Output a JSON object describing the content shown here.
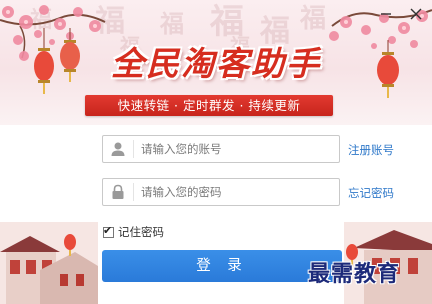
{
  "banner": {
    "app_title": "全民淘客助手",
    "slogan": "快速转链 · 定时群发 · 持续更新",
    "background_chars": [
      "福",
      "福",
      "福",
      "福",
      "福",
      "福",
      "福",
      "福"
    ]
  },
  "window_controls": {
    "minimize_icon": "minimize-icon",
    "close_icon": "close-icon"
  },
  "login_form": {
    "username": {
      "icon": "user-icon",
      "placeholder": "请输入您的账号",
      "value": ""
    },
    "password": {
      "icon": "lock-icon",
      "placeholder": "请输入您的密码",
      "value": ""
    },
    "register_link": "注册账号",
    "forgot_link": "忘记密码",
    "remember_label": "记住密码",
    "remember_checked": true,
    "login_button": "登 录"
  },
  "watermark": "最需教育",
  "colors": {
    "title_red": "#d62d1f",
    "slogan_red": "#c7241c",
    "link_blue": "#2f78c9",
    "button_blue": "#2a7ad9"
  }
}
